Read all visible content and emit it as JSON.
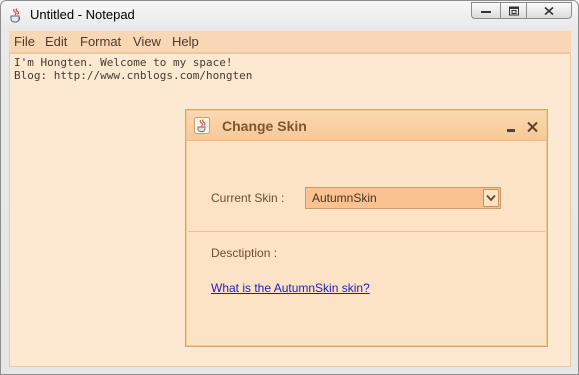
{
  "window": {
    "title": "Untitled - Notepad",
    "icons": {
      "app": "java-coffee-cup-icon",
      "minimize": "minimize-icon",
      "maximize": "maximize-icon",
      "close": "close-icon"
    }
  },
  "menubar": {
    "items": [
      "File",
      "Edit",
      "Format",
      "View",
      "Help"
    ]
  },
  "editor": {
    "lines": [
      "I'm Hongten. Welcome to my space!",
      "Blog: http://www.cnblogs.com/hongten"
    ]
  },
  "dialog": {
    "title": "Change Skin",
    "current_skin_label": "Current Skin :",
    "current_skin_value": "AutumnSkin",
    "description_label": "Desctiption :",
    "link_text": "What is the AutumnSkin skin?",
    "icons": {
      "title": "java-coffee-cup-icon",
      "minimize": "minimize-icon",
      "close": "close-icon",
      "dropdown": "chevron-down-icon"
    }
  },
  "colors": {
    "skin_background": "#fde8d1",
    "menubar": "#f9d7b4",
    "dialog_title": "#f6c996",
    "link": "#1c1cc4"
  }
}
